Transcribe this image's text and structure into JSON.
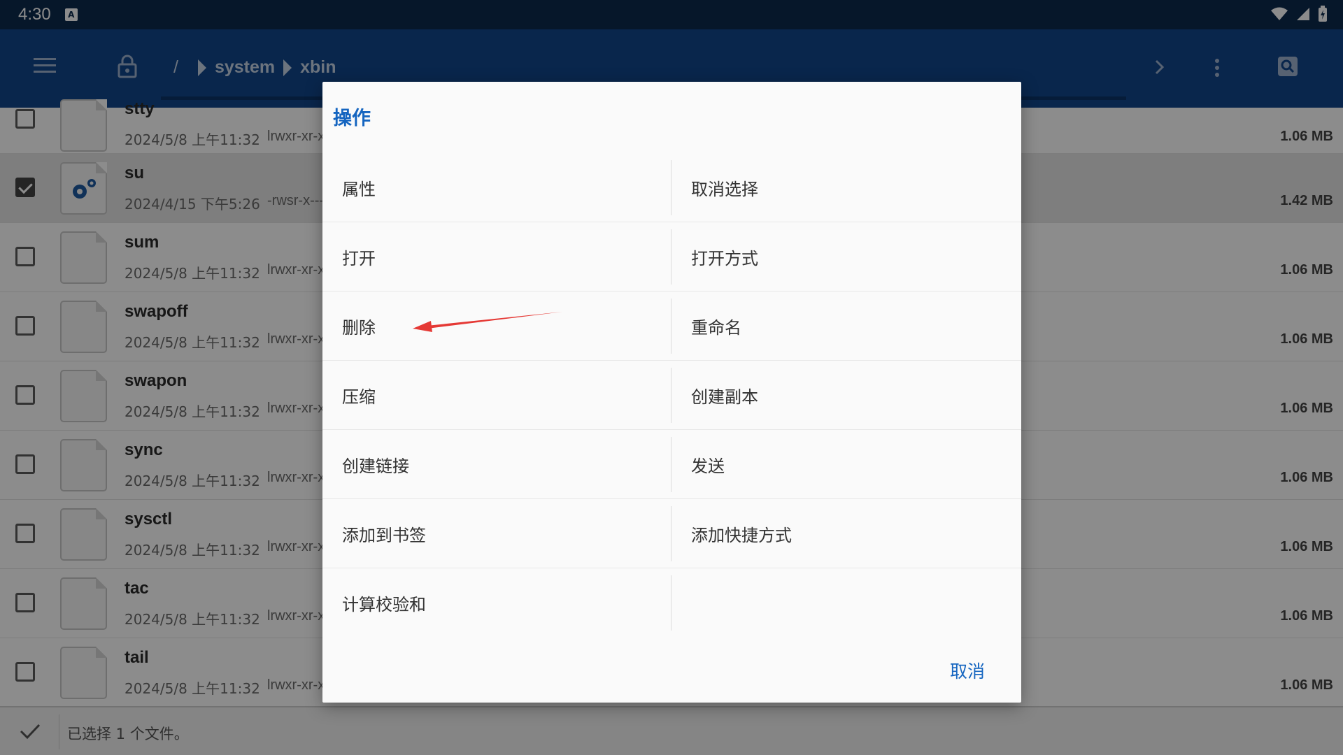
{
  "status_bar": {
    "time": "4:30",
    "badge": "A"
  },
  "app_bar": {
    "breadcrumb_root": "/",
    "breadcrumb": [
      "system",
      "xbin"
    ]
  },
  "files": [
    {
      "name": "stty",
      "date": "2024/5/8 上午11:32",
      "perm": "lrwxr-xr-x",
      "size": "1.06 MB",
      "selected": false,
      "partial": true
    },
    {
      "name": "su",
      "date": "2024/4/15 下午5:26",
      "perm": "-rwsr-x---",
      "size": "1.42 MB",
      "selected": true
    },
    {
      "name": "sum",
      "date": "2024/5/8 上午11:32",
      "perm": "lrwxr-xr-x",
      "size": "1.06 MB",
      "selected": false
    },
    {
      "name": "swapoff",
      "date": "2024/5/8 上午11:32",
      "perm": "lrwxr-xr-x",
      "size": "1.06 MB",
      "selected": false
    },
    {
      "name": "swapon",
      "date": "2024/5/8 上午11:32",
      "perm": "lrwxr-xr-x",
      "size": "1.06 MB",
      "selected": false
    },
    {
      "name": "sync",
      "date": "2024/5/8 上午11:32",
      "perm": "lrwxr-xr-x",
      "size": "1.06 MB",
      "selected": false
    },
    {
      "name": "sysctl",
      "date": "2024/5/8 上午11:32",
      "perm": "lrwxr-xr-x",
      "size": "1.06 MB",
      "selected": false
    },
    {
      "name": "tac",
      "date": "2024/5/8 上午11:32",
      "perm": "lrwxr-xr-x",
      "size": "1.06 MB",
      "selected": false
    },
    {
      "name": "tail",
      "date": "2024/5/8 上午11:32",
      "perm": "lrwxr-xr-x",
      "size": "1.06 MB",
      "selected": false
    }
  ],
  "bottom_bar": {
    "status": "已选择 1 个文件。"
  },
  "dialog": {
    "title": "操作",
    "options": [
      [
        "属性",
        "取消选择"
      ],
      [
        "打开",
        "打开方式"
      ],
      [
        "删除",
        "重命名"
      ],
      [
        "压缩",
        "创建副本"
      ],
      [
        "创建链接",
        "发送"
      ],
      [
        "添加到书签",
        "添加快捷方式"
      ],
      [
        "计算校验和",
        ""
      ]
    ],
    "cancel_label": "取消"
  },
  "colors": {
    "status_bar": "#0c2a4e",
    "app_bar": "#12468a",
    "accent": "#1565c0",
    "annotation_arrow": "#e53935"
  }
}
